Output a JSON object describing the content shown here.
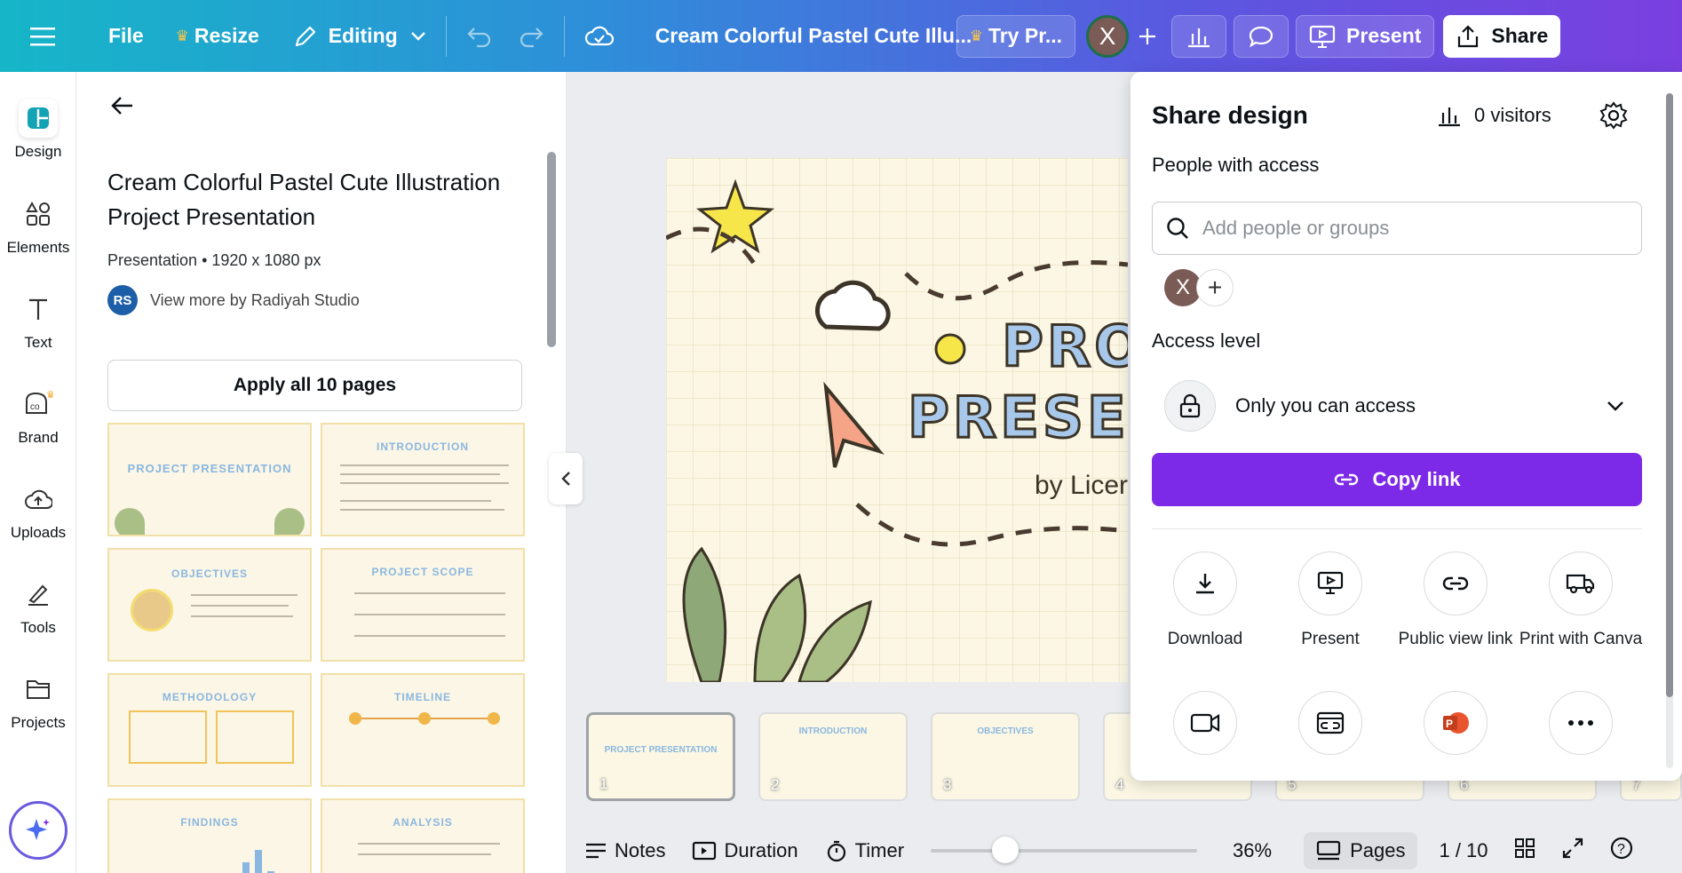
{
  "topbar": {
    "file": "File",
    "resize": "Resize",
    "editing": "Editing",
    "doc_title": "Cream Colorful Pastel Cute Illu...",
    "try_pro": "Try Pr...",
    "avatar_letter": "X",
    "present": "Present",
    "share": "Share"
  },
  "rail": {
    "items": [
      {
        "label": "Design",
        "icon": "design-icon"
      },
      {
        "label": "Elements",
        "icon": "elements-icon"
      },
      {
        "label": "Text",
        "icon": "text-icon"
      },
      {
        "label": "Brand",
        "icon": "brand-icon"
      },
      {
        "label": "Uploads",
        "icon": "uploads-icon"
      },
      {
        "label": "Tools",
        "icon": "tools-icon"
      },
      {
        "label": "Projects",
        "icon": "projects-icon"
      }
    ]
  },
  "panel": {
    "title": "Cream Colorful Pastel Cute Illustration Project Presentation",
    "meta": "Presentation • 1920 x 1080 px",
    "author_initials": "RS",
    "author": "View more by Radiyah Studio",
    "apply": "Apply all 10 pages",
    "thumbnails": [
      {
        "title": "PROJECT PRESENTATION"
      },
      {
        "title": "INTRODUCTION"
      },
      {
        "title": "OBJECTIVES"
      },
      {
        "title": "PROJECT SCOPE"
      },
      {
        "title": "METHODOLOGY"
      },
      {
        "title": "TIMELINE"
      },
      {
        "title": "FINDINGS"
      },
      {
        "title": "ANALYSIS"
      }
    ]
  },
  "slide": {
    "line1": "PROJ",
    "line2": "PRESEN",
    "byline": "by Licer"
  },
  "strip": {
    "pages": [
      {
        "num": "1",
        "title": "PROJECT PRESENTATION"
      },
      {
        "num": "2",
        "title": "INTRODUCTION"
      },
      {
        "num": "3",
        "title": "OBJECTIVES"
      },
      {
        "num": "4",
        "title": ""
      },
      {
        "num": "5",
        "title": ""
      },
      {
        "num": "6",
        "title": ""
      },
      {
        "num": "7",
        "title": ""
      }
    ]
  },
  "bottombar": {
    "notes": "Notes",
    "duration": "Duration",
    "timer": "Timer",
    "zoom": "36%",
    "zoom_fraction": 0.28,
    "pages": "Pages",
    "page_count": "1 / 10"
  },
  "share_panel": {
    "title": "Share design",
    "visitors": "0 visitors",
    "people_heading": "People with access",
    "search_placeholder": "Add people or groups",
    "access_heading": "Access level",
    "access_value": "Only you can access",
    "copy_link": "Copy link",
    "actions": [
      {
        "label": "Download",
        "icon": "download-icon"
      },
      {
        "label": "Present",
        "icon": "present-icon"
      },
      {
        "label": "Public view link",
        "icon": "link-icon"
      },
      {
        "label": "Print with Canva",
        "icon": "truck-icon"
      }
    ],
    "actions_row2": [
      {
        "icon": "video-icon"
      },
      {
        "icon": "website-icon"
      },
      {
        "icon": "powerpoint-icon"
      },
      {
        "icon": "more-icon"
      }
    ]
  },
  "colors": {
    "accent_purple": "#7d2ae8",
    "topbar_start": "#16b6c8",
    "topbar_end": "#7a3fe0"
  }
}
